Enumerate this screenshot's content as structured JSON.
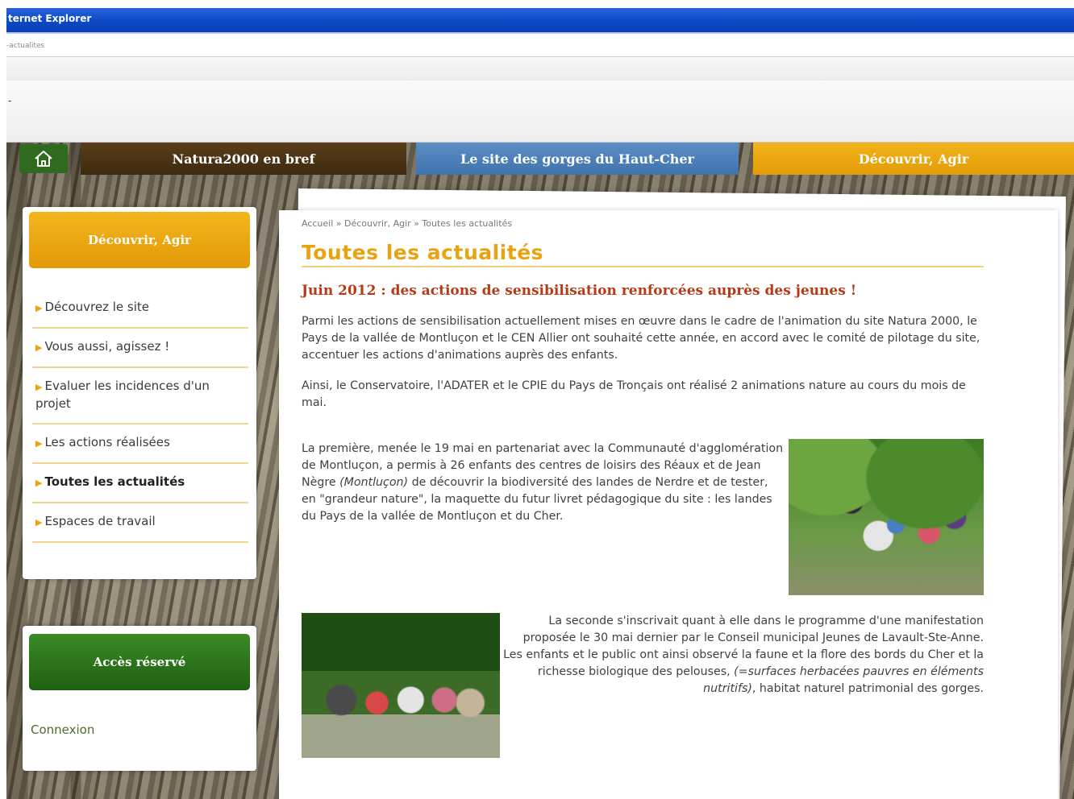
{
  "browser": {
    "title": "ternet Explorer",
    "address": "-actualites"
  },
  "nav": {
    "home_icon": "home-icon",
    "tabs": [
      {
        "label": "Natura2000 en bref",
        "color": "#4a3214"
      },
      {
        "label": "Le site des gorges du Haut-Cher",
        "color": "#4d82bb"
      },
      {
        "label": "Découvrir, Agir",
        "color": "#eca610"
      }
    ]
  },
  "sidebar": {
    "heading": "Découvrir, Agir",
    "items": [
      {
        "label": "Découvrez le site"
      },
      {
        "label": "Vous aussi, agissez !"
      },
      {
        "label": "Evaluer les incidences d'un projet"
      },
      {
        "label": "Les actions réalisées"
      },
      {
        "label": "Toutes les actualités",
        "active": true
      },
      {
        "label": "Espaces de travail"
      }
    ]
  },
  "access": {
    "heading": "Accès réservé",
    "link": "Connexion"
  },
  "main": {
    "breadcrumb": "Accueil » Découvrir, Agir » Toutes les actualités",
    "title": "Toutes les actualités",
    "article_title": "Juin 2012 : des actions de sensibilisation renforcées auprès des jeunes !",
    "p1": "Parmi les actions de sensibilisation actuellement mises en œuvre dans le cadre de l'animation du site Natura 2000, le Pays de la vallée de Montluçon et le CEN Allier ont souhaité cette année, en accord avec le comité de pilotage du site, accentuer les actions d'animations auprès des enfants.",
    "p2": "Ainsi, le Conservatoire, l'ADATER et le CPIE du Pays de Tronçais  ont réalisé 2 animations nature au cours du mois de mai.",
    "p3_a": "La première, menée le 19 mai en partenariat avec la Communauté d'agglomération de Montluçon, a permis à 26 enfants des centres de loisirs des Réaux et de Jean Nègre ",
    "p3_em": "(Montluçon)",
    "p3_b": " de découvrir la biodiversité des landes de Nerdre et de tester, en \"grandeur nature\", la maquette du futur livret pédagogique du site : les landes du Pays de la vallée de Montluçon et du Cher.",
    "p4_a": "La seconde s'inscrivait quant à elle dans le programme d'une manifestation proposée le 30 mai dernier par le Conseil municipal Jeunes de Lavault-Ste-Anne. Les enfants et le public ont ainsi observé la faune et la flore des bords du Cher et la richesse biologique des pelouses, ",
    "p4_em": "(=surfaces herbacées pauvres en éléments nutritifs)",
    "p4_b": ", habitat naturel patrimonial des gorges."
  }
}
